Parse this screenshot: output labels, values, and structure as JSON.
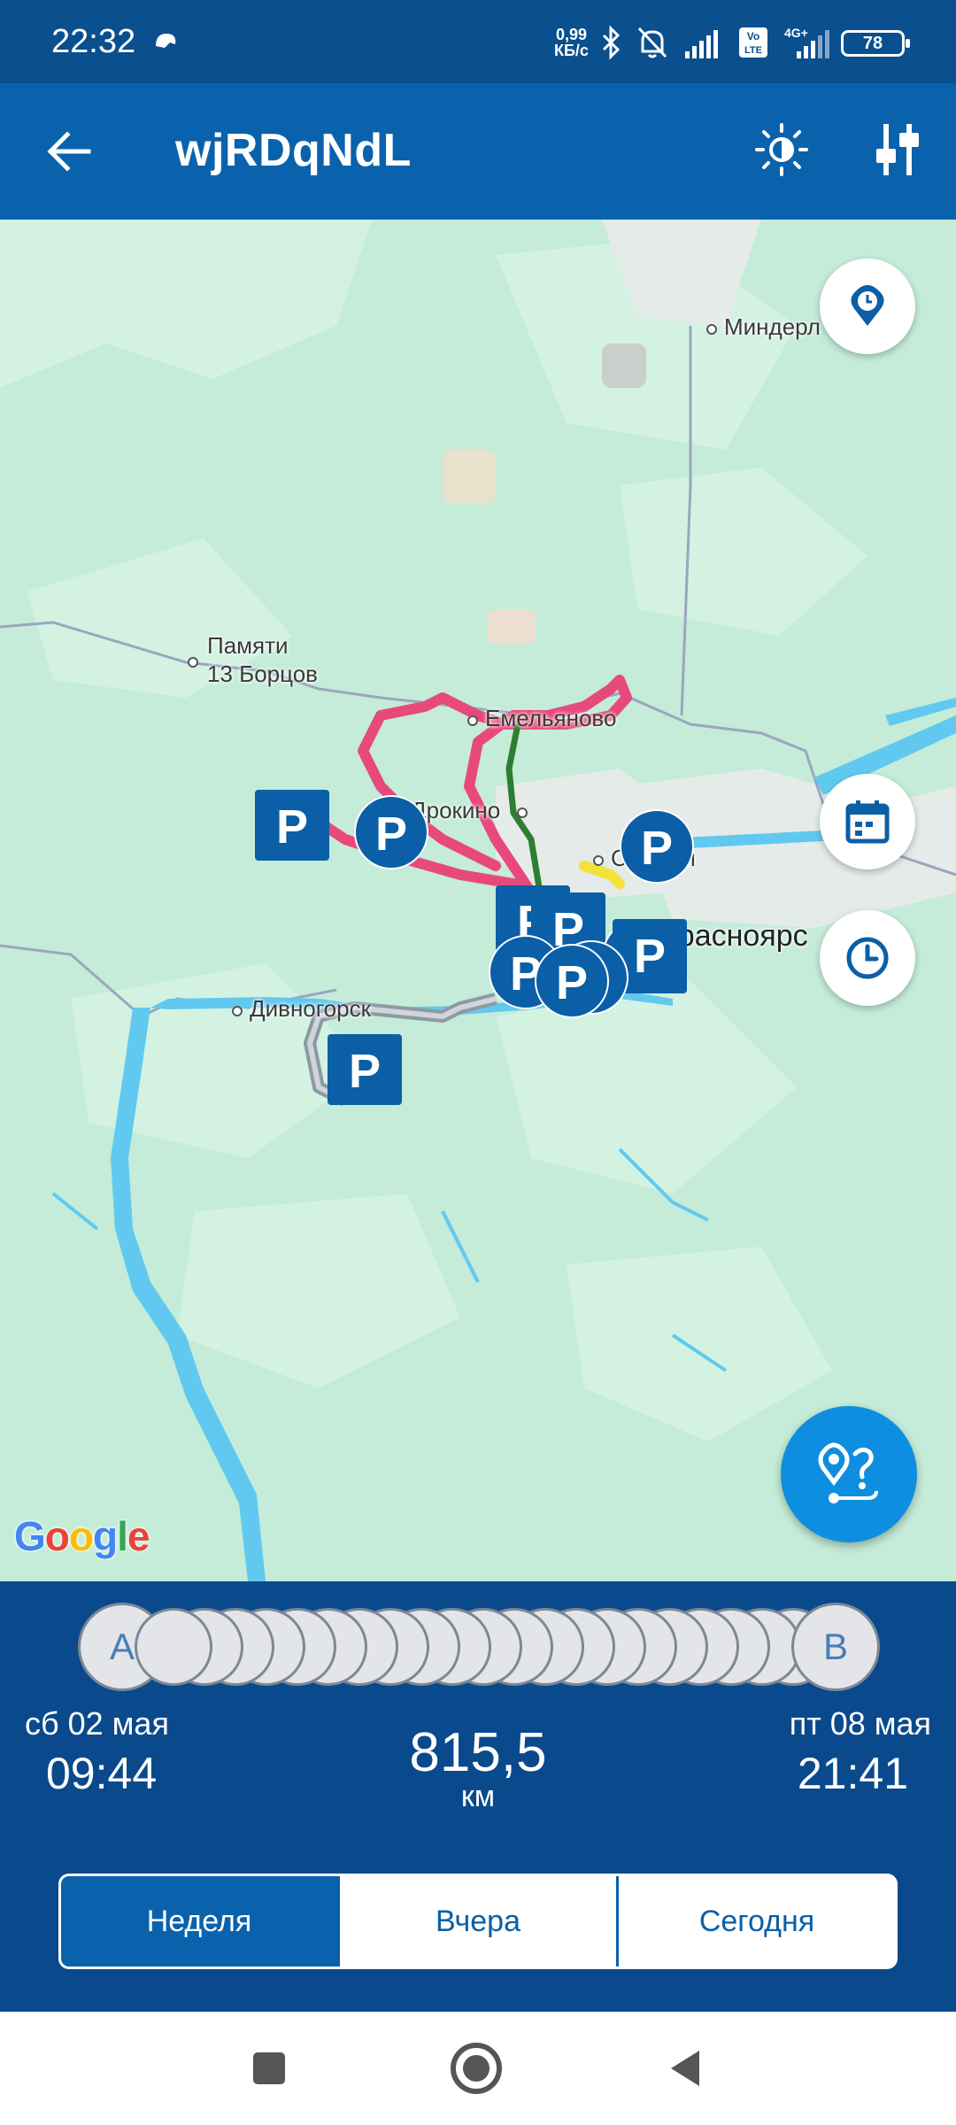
{
  "status_bar": {
    "time": "22:32",
    "speed_value": "0,99",
    "speed_unit": "КБ/с",
    "network_type": "4G+",
    "volte": "Vo LTE",
    "battery": "78"
  },
  "app_bar": {
    "title": "wjRDqNdL",
    "back_icon": "arrow-left-icon",
    "theme_icon": "brightness-icon",
    "filters_icon": "sliders-icon"
  },
  "map": {
    "labels": {
      "minderla": "Миндерл",
      "pamyati": "Памяти",
      "borcov": "13 Борцов",
      "emelyanovo": "Емельяново",
      "drokino": "Дрокино",
      "solontsy": "Солнцы",
      "krasnoyarsk": "Красноярс",
      "divnogorsk": "Дивногорск"
    },
    "parking_label": "P",
    "provider": "Google",
    "route_colors": {
      "pink": "#e8497d",
      "green": "#2e7d32",
      "gray": "#8e99a4",
      "yellow": "#f2e23a"
    },
    "map_buttons": [
      "location-pin-icon",
      "calendar-icon",
      "clock-icon"
    ],
    "route_fab_icon": "route-icon"
  },
  "panel": {
    "start_marker": "A",
    "end_marker": "B",
    "start_date": "сб 02 мая",
    "start_time": "09:44",
    "end_date": "пт 08 мая",
    "end_time": "21:41",
    "distance": "815,5",
    "distance_unit": "км",
    "segments": [
      {
        "label": "Неделя",
        "active": true
      },
      {
        "label": "Вчера",
        "active": false
      },
      {
        "label": "Сегодня",
        "active": false
      }
    ]
  },
  "nav_bar": {
    "recents_icon": "square-icon",
    "home_icon": "circle-icon",
    "back_icon": "triangle-back-icon"
  }
}
